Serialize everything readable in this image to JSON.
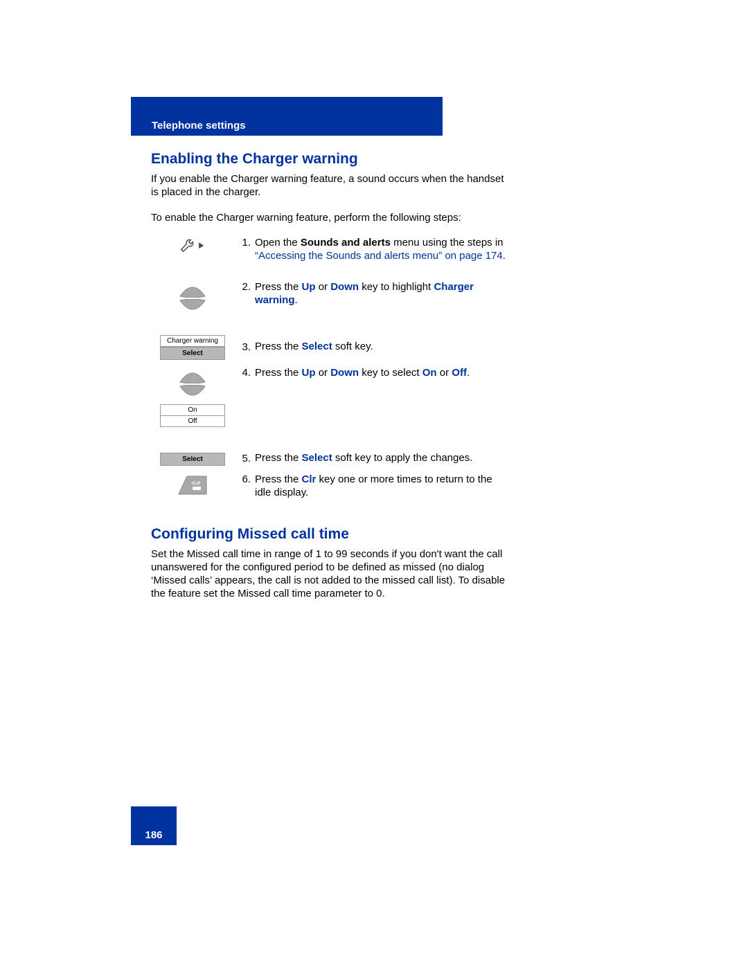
{
  "header": {
    "section": "Telephone settings"
  },
  "section1": {
    "heading": "Enabling the Charger warning",
    "intro": "If you enable the Charger warning feature, a sound occurs when the handset is placed in the charger.",
    "lead": "To enable the Charger warning feature, perform the following steps:"
  },
  "steps": {
    "s1_num": "1.",
    "s1_a": "Open the ",
    "s1_b": "Sounds and alerts",
    "s1_c": " menu using the steps in ",
    "s1_d": "“Accessing the Sounds and alerts menu” on page 174",
    "s1_e": ".",
    "s2_num": "2.",
    "s2_a": "Press the ",
    "s2_b": "Up",
    "s2_c": " or ",
    "s2_d": "Down",
    "s2_e": " key to highlight ",
    "s2_f": "Charger warning",
    "s2_g": ".",
    "s3_num": "3.",
    "s3_a": "Press the ",
    "s3_b": "Select",
    "s3_c": " soft key.",
    "s4_num": "4.",
    "s4_a": "Press the ",
    "s4_b": "Up",
    "s4_c": " or ",
    "s4_d": "Down",
    "s4_e": " key to select ",
    "s4_f": "On",
    "s4_g": " or ",
    "s4_h": "Off",
    "s4_i": ".",
    "s5_num": "5.",
    "s5_a": "Press the ",
    "s5_b": "Select",
    "s5_c": " soft key to apply the changes.",
    "s6_num": "6.",
    "s6_a": "Press the ",
    "s6_b": "Clr",
    "s6_c": " key one or more times to return to the idle display."
  },
  "ui": {
    "charger_warning": "Charger warning",
    "select": "Select",
    "on": "On",
    "off": "Off"
  },
  "section2": {
    "heading": "Configuring Missed call time",
    "body": "Set the Missed call time in range of 1 to 99 seconds if you don't want the call unanswered for the configured period to be defined as missed (no dialog ‘Missed calls’ appears, the call is not added to the missed call list). To disable the feature set the Missed call time parameter to 0."
  },
  "footer": {
    "page": "186"
  }
}
